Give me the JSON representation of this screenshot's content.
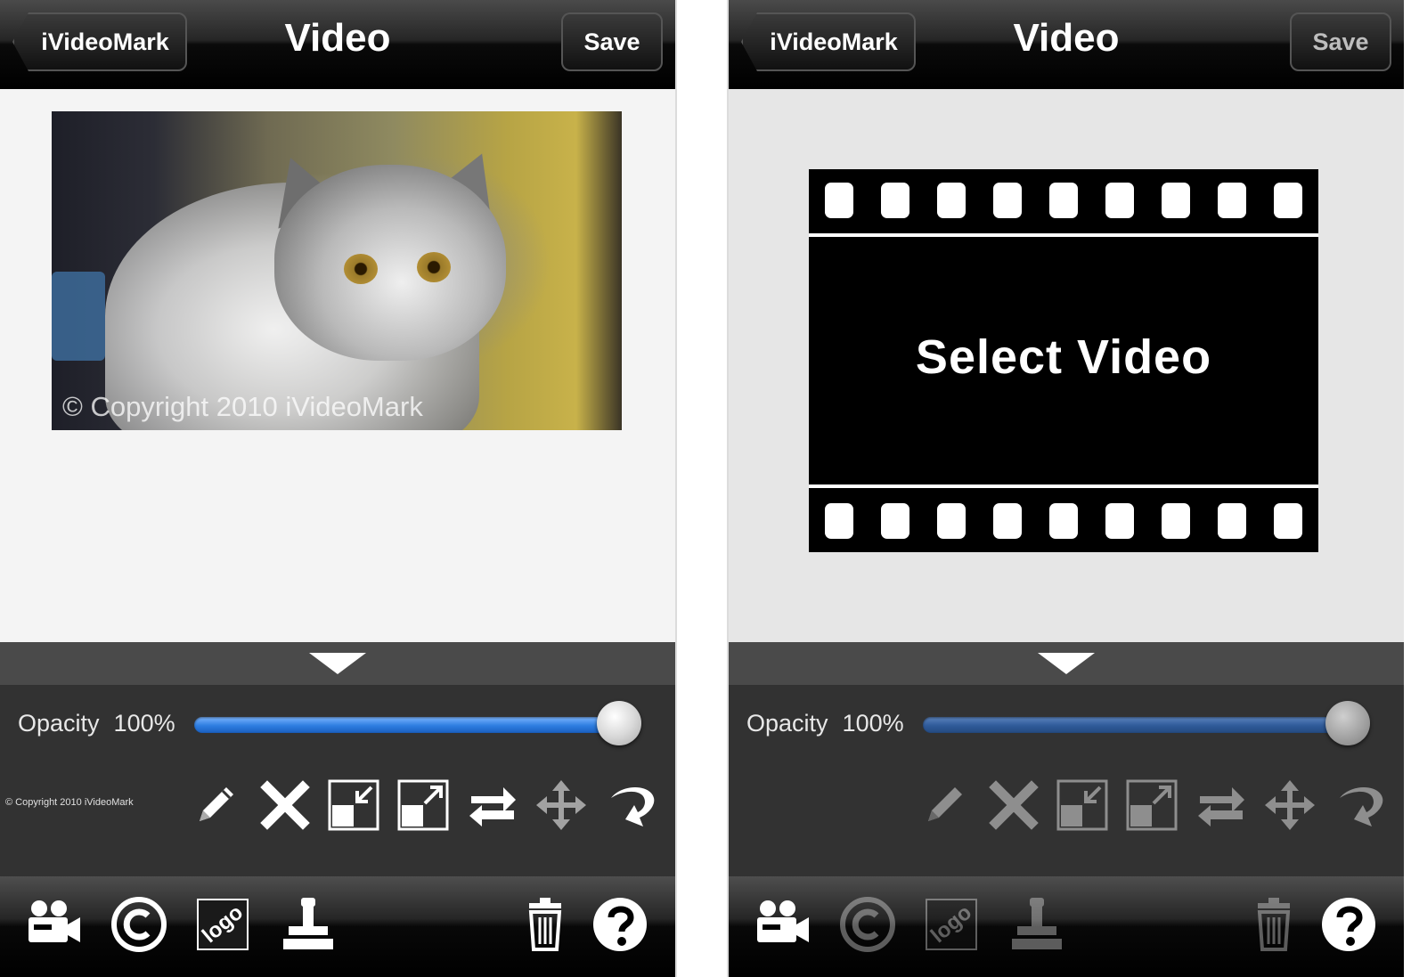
{
  "screens": {
    "left": {
      "nav": {
        "back_label": "iVideoMark",
        "title": "Video",
        "save_label": "Save"
      },
      "preview": {
        "watermark": "© Copyright 2010 iVideoMark"
      },
      "panel": {
        "opacity_label": "Opacity",
        "opacity_value": "100%",
        "opacity_level": 1.0,
        "watermark_preview": "© Copyright 2010 iVideoMark"
      },
      "toolbar": {
        "logo_text": "logo"
      }
    },
    "right": {
      "nav": {
        "back_label": "iVideoMark",
        "title": "Video",
        "save_label": "Save"
      },
      "placeholder": {
        "label": "Select Video"
      },
      "panel": {
        "opacity_label": "Opacity",
        "opacity_value": "100%",
        "opacity_level": 1.0
      },
      "toolbar": {
        "logo_text": "logo"
      }
    }
  },
  "edit_tools": [
    "pencil-icon",
    "delete-x-icon",
    "shrink-icon",
    "enlarge-icon",
    "swap-arrows-icon",
    "move-icon",
    "rotate-icon"
  ],
  "bottom_tools": [
    "video-camera-icon",
    "copyright-icon",
    "logo-icon",
    "stamp-icon",
    "trash-icon",
    "help-icon"
  ],
  "colors": {
    "slider_active": "#2d7de0",
    "slider_inactive": "#2f5a99",
    "panel_bg": "#323232",
    "navbar_bg": "#000000"
  }
}
